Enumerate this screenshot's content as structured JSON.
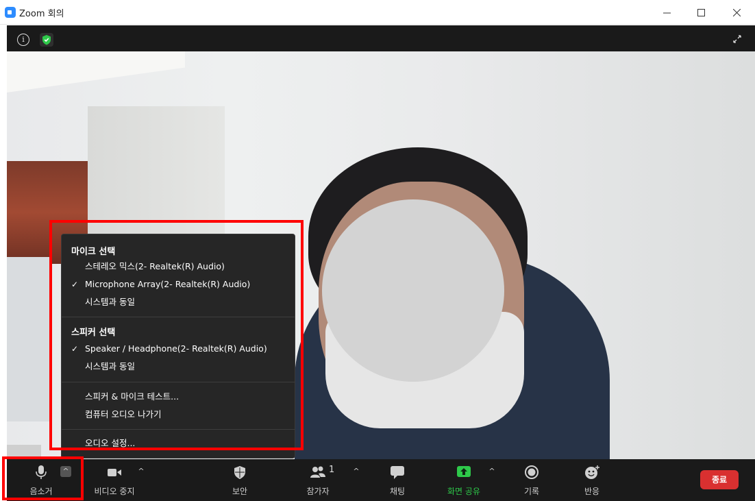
{
  "window": {
    "title": "Zoom 회의",
    "minimize_glyph": "─",
    "maximize_glyph": "☐",
    "close_glyph": "✕"
  },
  "meeting_top": {
    "info_glyph": "i"
  },
  "audio_menu": {
    "mic_header": "마이크 선택",
    "mic_options": [
      {
        "label": "스테레오 믹스(2- Realtek(R) Audio)",
        "checked": false
      },
      {
        "label": "Microphone Array(2- Realtek(R) Audio)",
        "checked": true
      },
      {
        "label": "시스템과 동일",
        "checked": false
      }
    ],
    "speaker_header": "스피커 선택",
    "speaker_options": [
      {
        "label": "Speaker / Headphone(2- Realtek(R) Audio)",
        "checked": true
      },
      {
        "label": "시스템과 동일",
        "checked": false
      }
    ],
    "actions": [
      {
        "label": "스피커 & 마이크 테스트..."
      },
      {
        "label": "컴퓨터 오디오 나가기"
      }
    ],
    "settings": "오디오 설정...",
    "check_glyph": "✓"
  },
  "toolbar": {
    "mute": "음소거",
    "video": "비디오 중지",
    "security": "보안",
    "participants": "참가자",
    "participants_count": "1",
    "chat": "채팅",
    "share": "화면 공유",
    "record": "기록",
    "reactions": "반응",
    "end": "종료",
    "caret_glyph": "^"
  },
  "colors": {
    "accent_green": "#2ec94a",
    "end_red": "#d93030",
    "highlight_red": "#ff0000",
    "zoom_blue": "#2d8cff"
  }
}
